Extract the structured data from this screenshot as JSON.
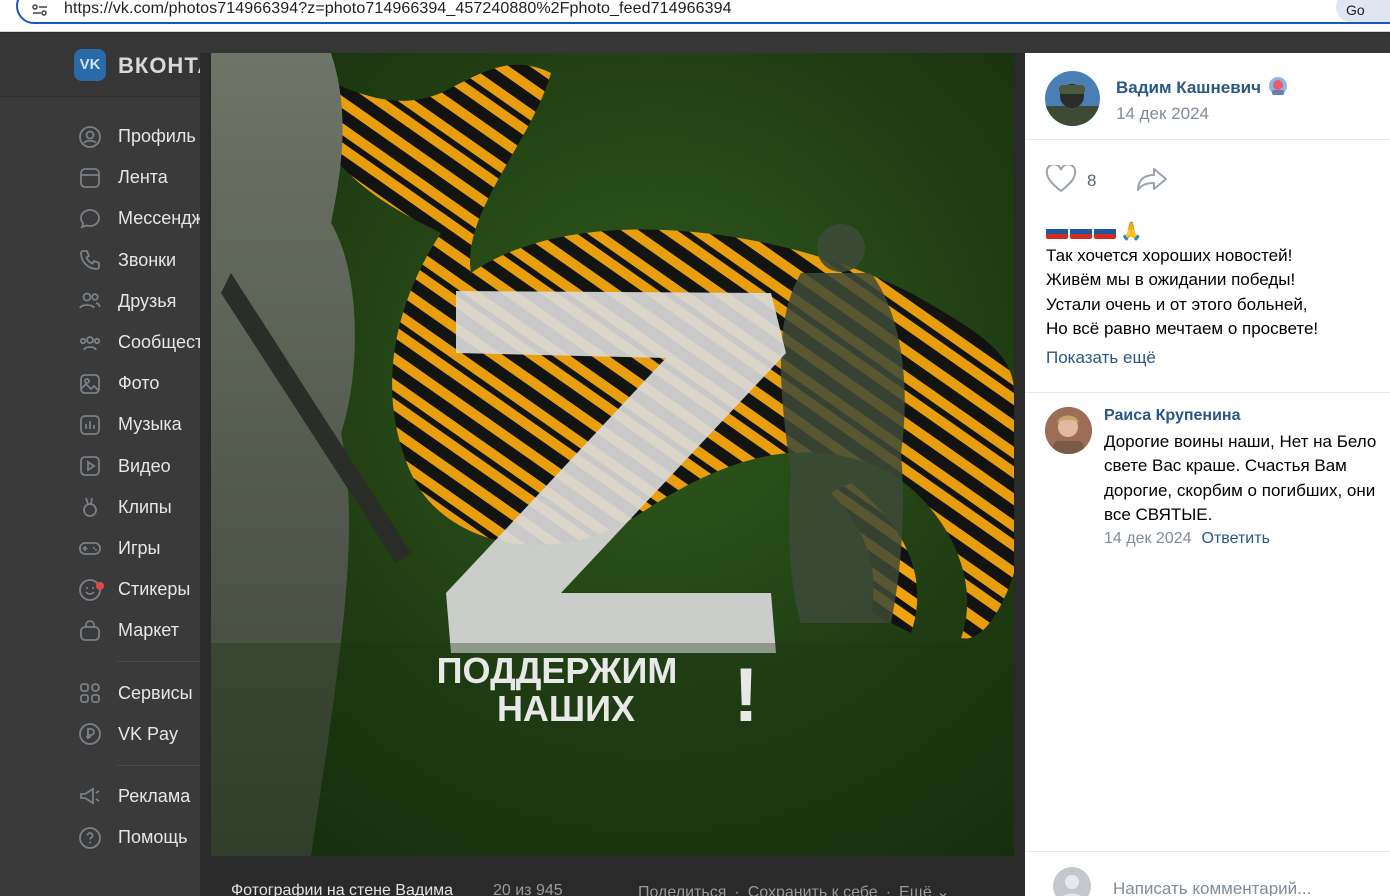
{
  "browser": {
    "url": "https://vk.com/photos714966394?z=photo714966394_457240880%2Fphoto_feed714966394",
    "lens_label": "Go"
  },
  "header": {
    "logo_text": "VK",
    "brand": "ВКОНТАКТЕ"
  },
  "sidebar": {
    "items": [
      {
        "label": "Профиль",
        "icon": "profile-icon"
      },
      {
        "label": "Лента",
        "icon": "feed-icon"
      },
      {
        "label": "Мессенджер",
        "icon": "messenger-icon"
      },
      {
        "label": "Звонки",
        "icon": "calls-icon"
      },
      {
        "label": "Друзья",
        "icon": "friends-icon"
      },
      {
        "label": "Сообщества",
        "icon": "communities-icon"
      },
      {
        "label": "Фото",
        "icon": "photo-icon"
      },
      {
        "label": "Музыка",
        "icon": "music-icon"
      },
      {
        "label": "Видео",
        "icon": "video-icon"
      },
      {
        "label": "Клипы",
        "icon": "clips-icon"
      },
      {
        "label": "Игры",
        "icon": "games-icon"
      },
      {
        "label": "Стикеры",
        "icon": "stickers-icon"
      },
      {
        "label": "Маркет",
        "icon": "market-icon"
      }
    ],
    "secondary": [
      {
        "label": "Сервисы",
        "icon": "services-icon"
      },
      {
        "label": "VK Pay",
        "icon": "vkpay-icon"
      }
    ],
    "tertiary": [
      {
        "label": "Реклама",
        "icon": "ads-icon"
      },
      {
        "label": "Помощь",
        "icon": "help-icon"
      }
    ]
  },
  "photo": {
    "caption_line1": "ПОДДЕРЖИМ",
    "caption_line2": "НАШИХ",
    "caption_mark": "!",
    "big_letter": "Z",
    "colors": {
      "background": "#1f3a12",
      "ribbon_orange": "#f2a20c",
      "ribbon_black": "#111111"
    }
  },
  "footer": {
    "title": "Фотографии на стене Вадима",
    "count": "20 из 945",
    "share": "Поделиться",
    "save": "Сохранить к себе",
    "more": "Ещё"
  },
  "post": {
    "author": "Вадим Кашневич",
    "date": "14 дек 2024",
    "likes": "8",
    "emoji_line": "🇷🇺🇷🇺🇷🇺🙏",
    "lines": [
      "Так хочется хороших новостей!",
      "Живём мы в ожидании победы!",
      "Устали очень и от этого больней,",
      "Но всё равно мечтаем о просвете!"
    ],
    "show_more": "Показать ещё"
  },
  "comment": {
    "author": "Раиса Крупенина",
    "lines": [
      "Дорогие воины наши, Нет на Бело",
      "свете Вас краше. Счастья Вам",
      "дорогие, скорбим о погибших, они",
      "все СВЯТЫЕ."
    ],
    "date": "14 дек 2024",
    "reply": "Ответить"
  },
  "reply_input": {
    "placeholder": "Написать комментарий..."
  },
  "colors": {
    "link": "#2a5885",
    "muted": "#818c99",
    "accent": "#1a56c8"
  }
}
